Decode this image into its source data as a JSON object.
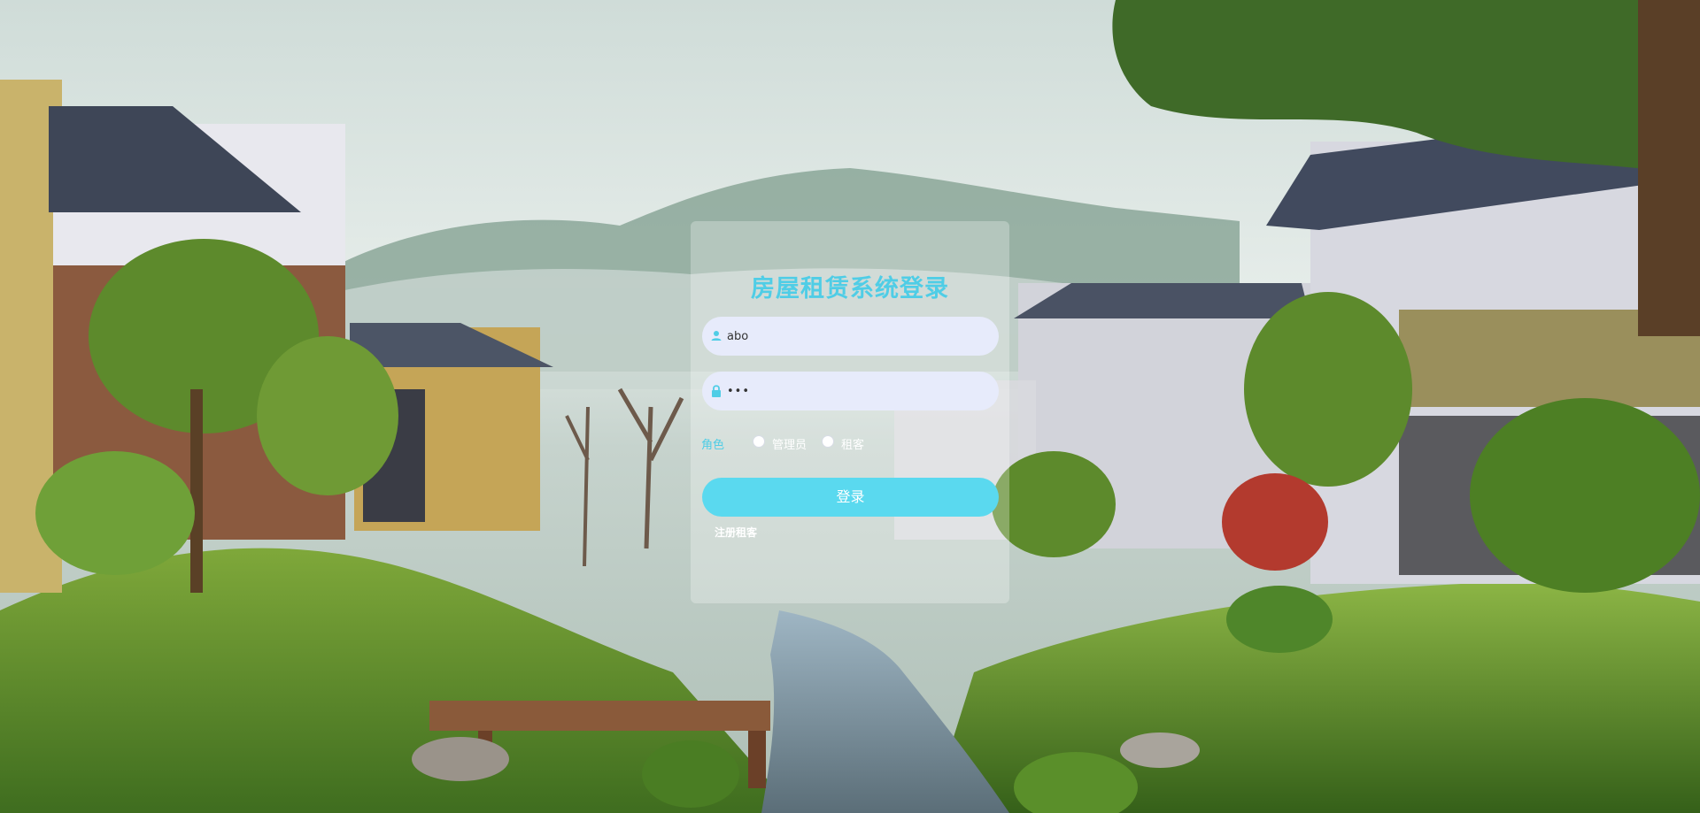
{
  "login": {
    "title": "房屋租赁系统登录",
    "username": {
      "value": "abo",
      "icon": "user-icon"
    },
    "password": {
      "value": "•••",
      "icon": "lock-icon"
    },
    "role": {
      "label": "角色",
      "options": [
        "管理员",
        "租客"
      ],
      "selected": null
    },
    "login_button": "登录",
    "register_link": "注册租客"
  },
  "colors": {
    "accent": "#4fcde6",
    "button": "#5ad9ef",
    "input_bg": "#e7ebfb"
  }
}
